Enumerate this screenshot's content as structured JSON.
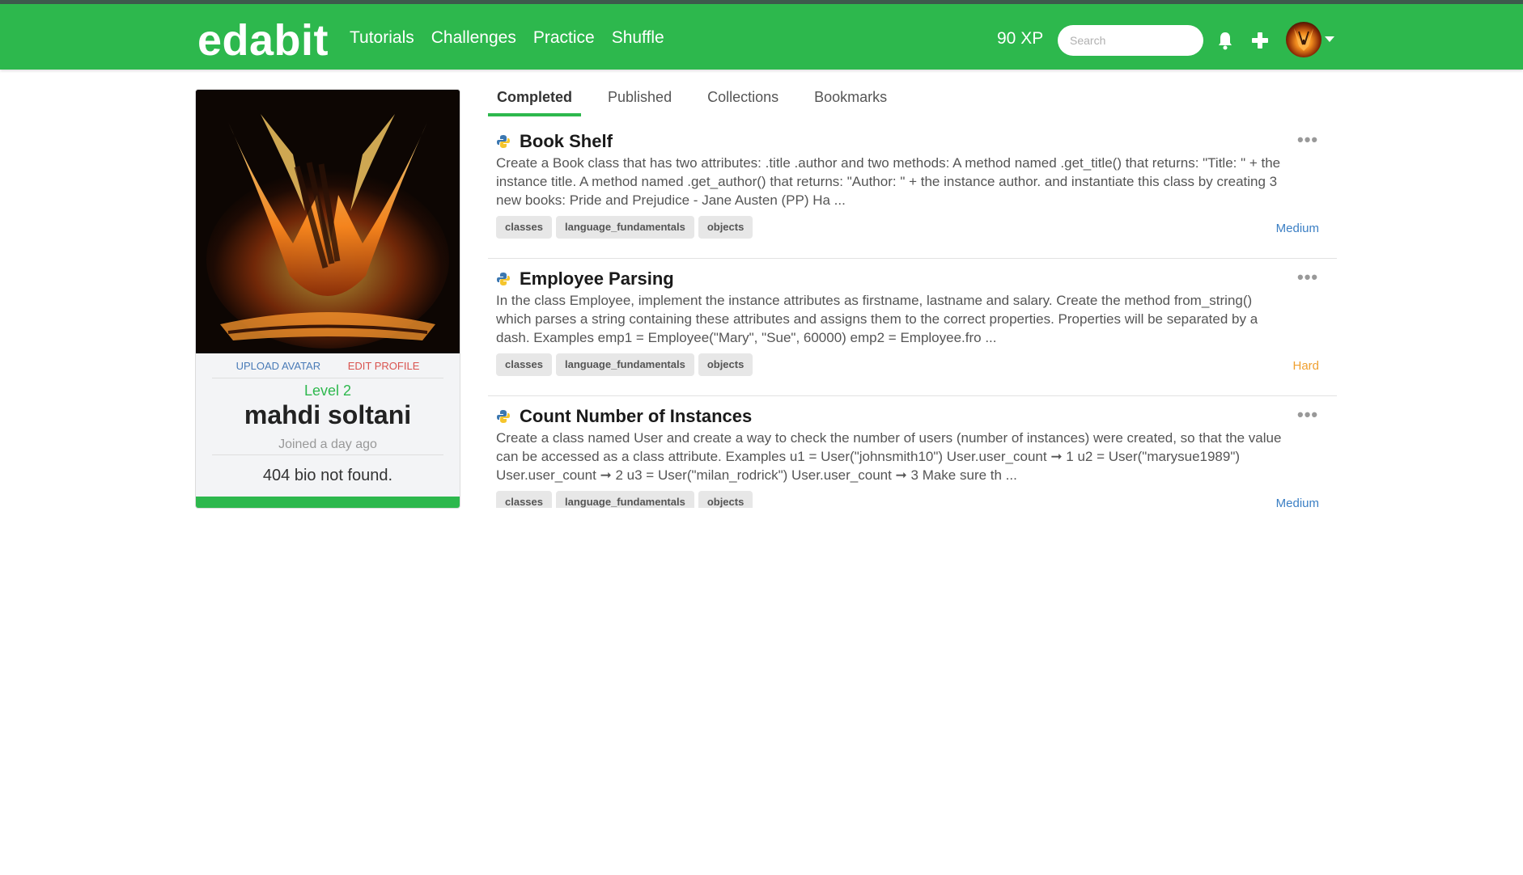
{
  "brand": {
    "logo": "edabit",
    "color": "#2db84d"
  },
  "nav": {
    "links": [
      "Tutorials",
      "Challenges",
      "Practice",
      "Shuffle"
    ],
    "xp": "90 XP",
    "search_placeholder": "Search",
    "icons": [
      "bell-icon",
      "plus-icon",
      "user-avatar",
      "caret-down-icon"
    ]
  },
  "profile": {
    "upload_avatar": "UPLOAD AVATAR",
    "edit": "EDIT ",
    "profile": "PROFILE",
    "level": "Level 2",
    "name": "mahdi soltani",
    "joined": "Joined a day ago",
    "bio": "404 bio not found."
  },
  "tabs": [
    {
      "label": "Completed",
      "active": true
    },
    {
      "label": "Published",
      "active": false
    },
    {
      "label": "Collections",
      "active": false
    },
    {
      "label": "Bookmarks",
      "active": false
    }
  ],
  "challenges": [
    {
      "title": "Book Shelf",
      "description": "Create a Book class that has two attributes: .title .author and two methods: A method named .get_title() that returns: \"Title: \" + the instance title. A method named .get_author() that returns: \"Author: \" + the instance author. and instantiate this class by creating 3 new books: Pride and Prejudice - Jane Austen (PP) Ha ...",
      "tags": [
        "classes",
        "language_fundamentals",
        "objects"
      ],
      "difficulty": "Medium"
    },
    {
      "title": "Employee Parsing",
      "description": "In the class Employee, implement the instance attributes as firstname, lastname and salary. Create the method from_string() which parses a string containing these attributes and assigns them to the correct properties. Properties will be separated by a dash. Examples emp1 = Employee(\"Mary\", \"Sue\", 60000) emp2 = Employee.fro ...",
      "tags": [
        "classes",
        "language_fundamentals",
        "objects"
      ],
      "difficulty": "Hard"
    },
    {
      "title": "Count Number of Instances",
      "description": "Create a class named User and create a way to check the number of users (number of instances) were created, so that the value can be accessed as a class attribute. Examples u1 = User(\"johnsmith10\") User.user_count ➞ 1 u2 = User(\"marysue1989\") User.user_count ➞ 2 u3 = User(\"milan_rodrick\") User.user_count ➞ 3 Make sure th ...",
      "tags": [
        "classes",
        "language_fundamentals",
        "objects"
      ],
      "difficulty": "Medium"
    }
  ],
  "more_label": "•••"
}
